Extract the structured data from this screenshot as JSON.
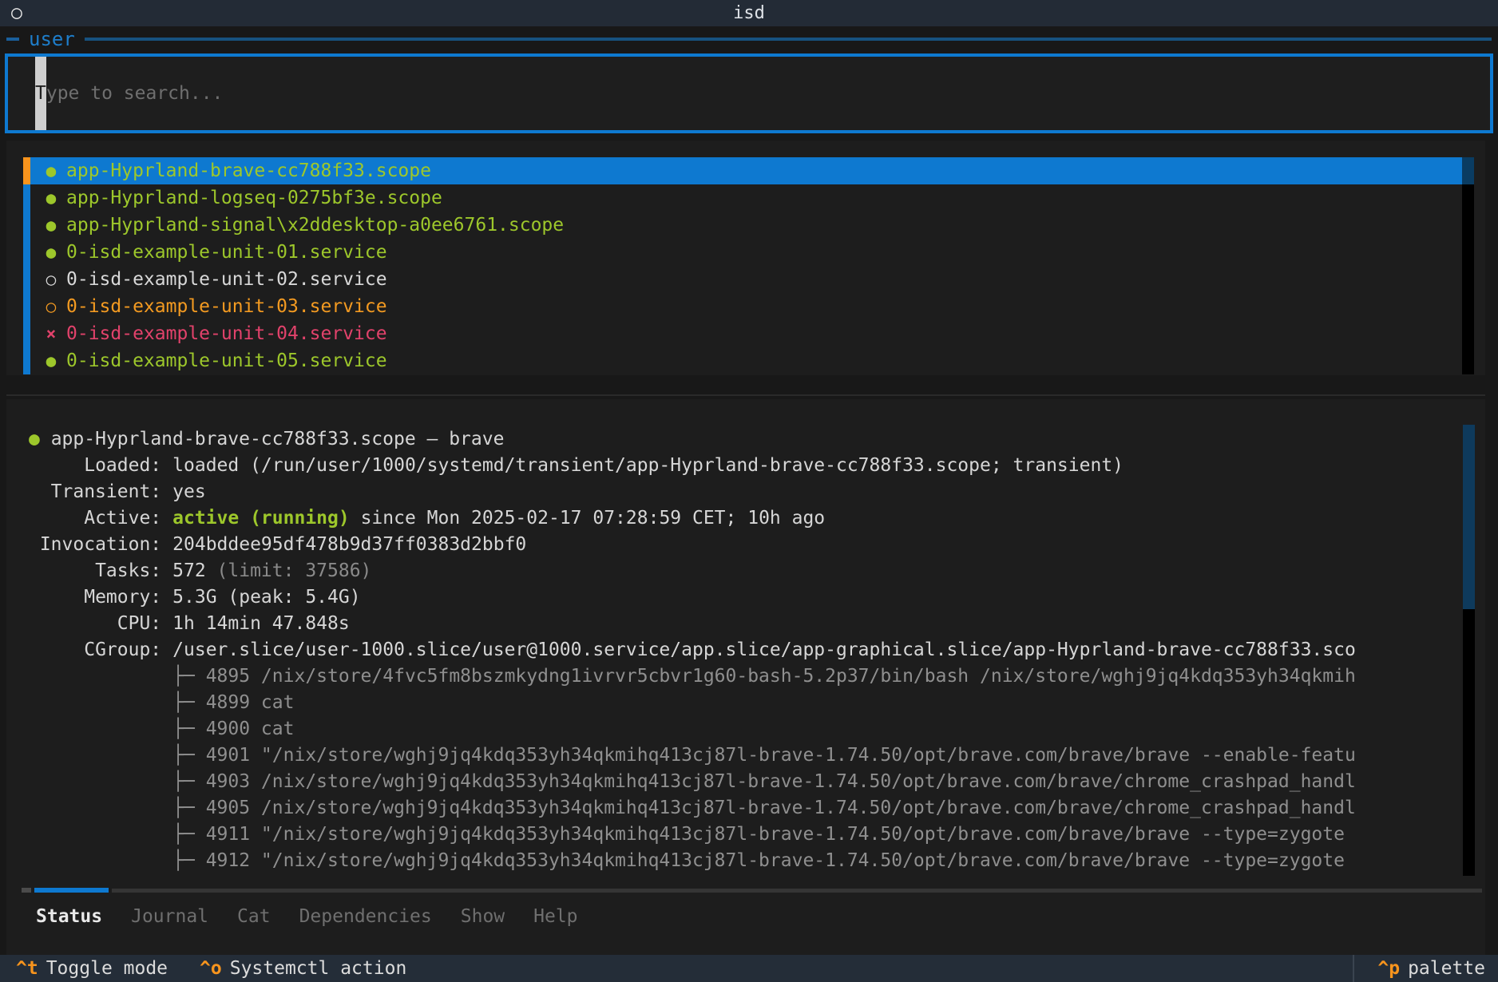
{
  "window": {
    "title": "isd",
    "icon": "○"
  },
  "panel": {
    "label": "user"
  },
  "search": {
    "cursor_char": "T",
    "placeholder_rest": "ype to search..."
  },
  "unit_list": {
    "state_icons": {
      "running": "●",
      "inactive": "○",
      "auto_restart": "○",
      "failed": "×"
    },
    "items": [
      {
        "name": "app-Hyprland-brave-cc788f33.scope",
        "state": "running",
        "selected": true
      },
      {
        "name": "app-Hyprland-logseq-0275bf3e.scope",
        "state": "running",
        "selected": false
      },
      {
        "name": "app-Hyprland-signal\\x2ddesktop-a0ee6761.scope",
        "state": "running",
        "selected": false
      },
      {
        "name": "0-isd-example-unit-01.service",
        "state": "running",
        "selected": false
      },
      {
        "name": "0-isd-example-unit-02.service",
        "state": "inactive",
        "selected": false
      },
      {
        "name": "0-isd-example-unit-03.service",
        "state": "auto_restart",
        "selected": false
      },
      {
        "name": "0-isd-example-unit-04.service",
        "state": "failed",
        "selected": false
      },
      {
        "name": "0-isd-example-unit-05.service",
        "state": "running",
        "selected": false
      }
    ]
  },
  "status": {
    "unit_icon": "● ",
    "unit_title": "app-Hyprland-brave-cc788f33.scope — brave",
    "fields": [
      {
        "label": "Loaded:",
        "parts": [
          {
            "text": "loaded (/run/user/1000/systemd/transient/app-Hyprland-brave-cc788f33.scope; transient)",
            "style": "normal"
          }
        ]
      },
      {
        "label": "Transient:",
        "parts": [
          {
            "text": "yes",
            "style": "normal"
          }
        ]
      },
      {
        "label": "Active:",
        "parts": [
          {
            "text": "active (running)",
            "style": "green-bold"
          },
          {
            "text": " since Mon 2025-02-17 07:28:59 CET; 10h ago",
            "style": "normal"
          }
        ]
      },
      {
        "label": "Invocation:",
        "parts": [
          {
            "text": "204bddee95df478b9d37ff0383d2bbf0",
            "style": "normal"
          }
        ]
      },
      {
        "label": "Tasks:",
        "parts": [
          {
            "text": "572 ",
            "style": "normal"
          },
          {
            "text": "(limit: 37586)",
            "style": "dim"
          }
        ]
      },
      {
        "label": "Memory:",
        "parts": [
          {
            "text": "5.3G (peak: 5.4G)",
            "style": "normal"
          }
        ]
      },
      {
        "label": "CPU:",
        "parts": [
          {
            "text": "1h 14min 47.848s",
            "style": "normal"
          }
        ]
      },
      {
        "label": "CGroup:",
        "parts": [
          {
            "text": "/user.slice/user-1000.slice/user@1000.service/app.slice/app-graphical.slice/app-Hyprland-brave-cc788f33.sco",
            "style": "normal"
          }
        ]
      }
    ],
    "cgroup_children": [
      "├─ 4895 /nix/store/4fvc5fm8bszmkydng1ivrvr5cbvr1g60-bash-5.2p37/bin/bash /nix/store/wghj9jq4kdq353yh34qkmih",
      "├─ 4899 cat",
      "├─ 4900 cat",
      "├─ 4901 \"/nix/store/wghj9jq4kdq353yh34qkmihq413cj87l-brave-1.74.50/opt/brave.com/brave/brave --enable-featu",
      "├─ 4903 /nix/store/wghj9jq4kdq353yh34qkmihq413cj87l-brave-1.74.50/opt/brave.com/brave/chrome_crashpad_handl",
      "├─ 4905 /nix/store/wghj9jq4kdq353yh34qkmihq413cj87l-brave-1.74.50/opt/brave.com/brave/chrome_crashpad_handl",
      "├─ 4911 \"/nix/store/wghj9jq4kdq353yh34qkmihq413cj87l-brave-1.74.50/opt/brave.com/brave/brave --type=zygote",
      "├─ 4912 \"/nix/store/wghj9jq4kdq353yh34qkmihq413cj87l-brave-1.74.50/opt/brave.com/brave/brave --type=zygote"
    ]
  },
  "tabs": {
    "active": "Status",
    "items": [
      "Status",
      "Journal",
      "Cat",
      "Dependencies",
      "Show",
      "Help"
    ]
  },
  "footer": {
    "left": [
      {
        "key": "^t",
        "label": "Toggle mode"
      },
      {
        "key": "^o",
        "label": "Systemctl action"
      }
    ],
    "right": [
      {
        "key": "^p",
        "label": "palette"
      }
    ]
  },
  "colors": {
    "accent_blue": "#0e79d0",
    "selected_bar_orange": "#f7941d",
    "state_green": "#9dc72b",
    "state_orange": "#f39a21",
    "state_red": "#e2426b",
    "scrollbar_thumb": "#0e3a5c",
    "bar_background": "#242d38"
  }
}
